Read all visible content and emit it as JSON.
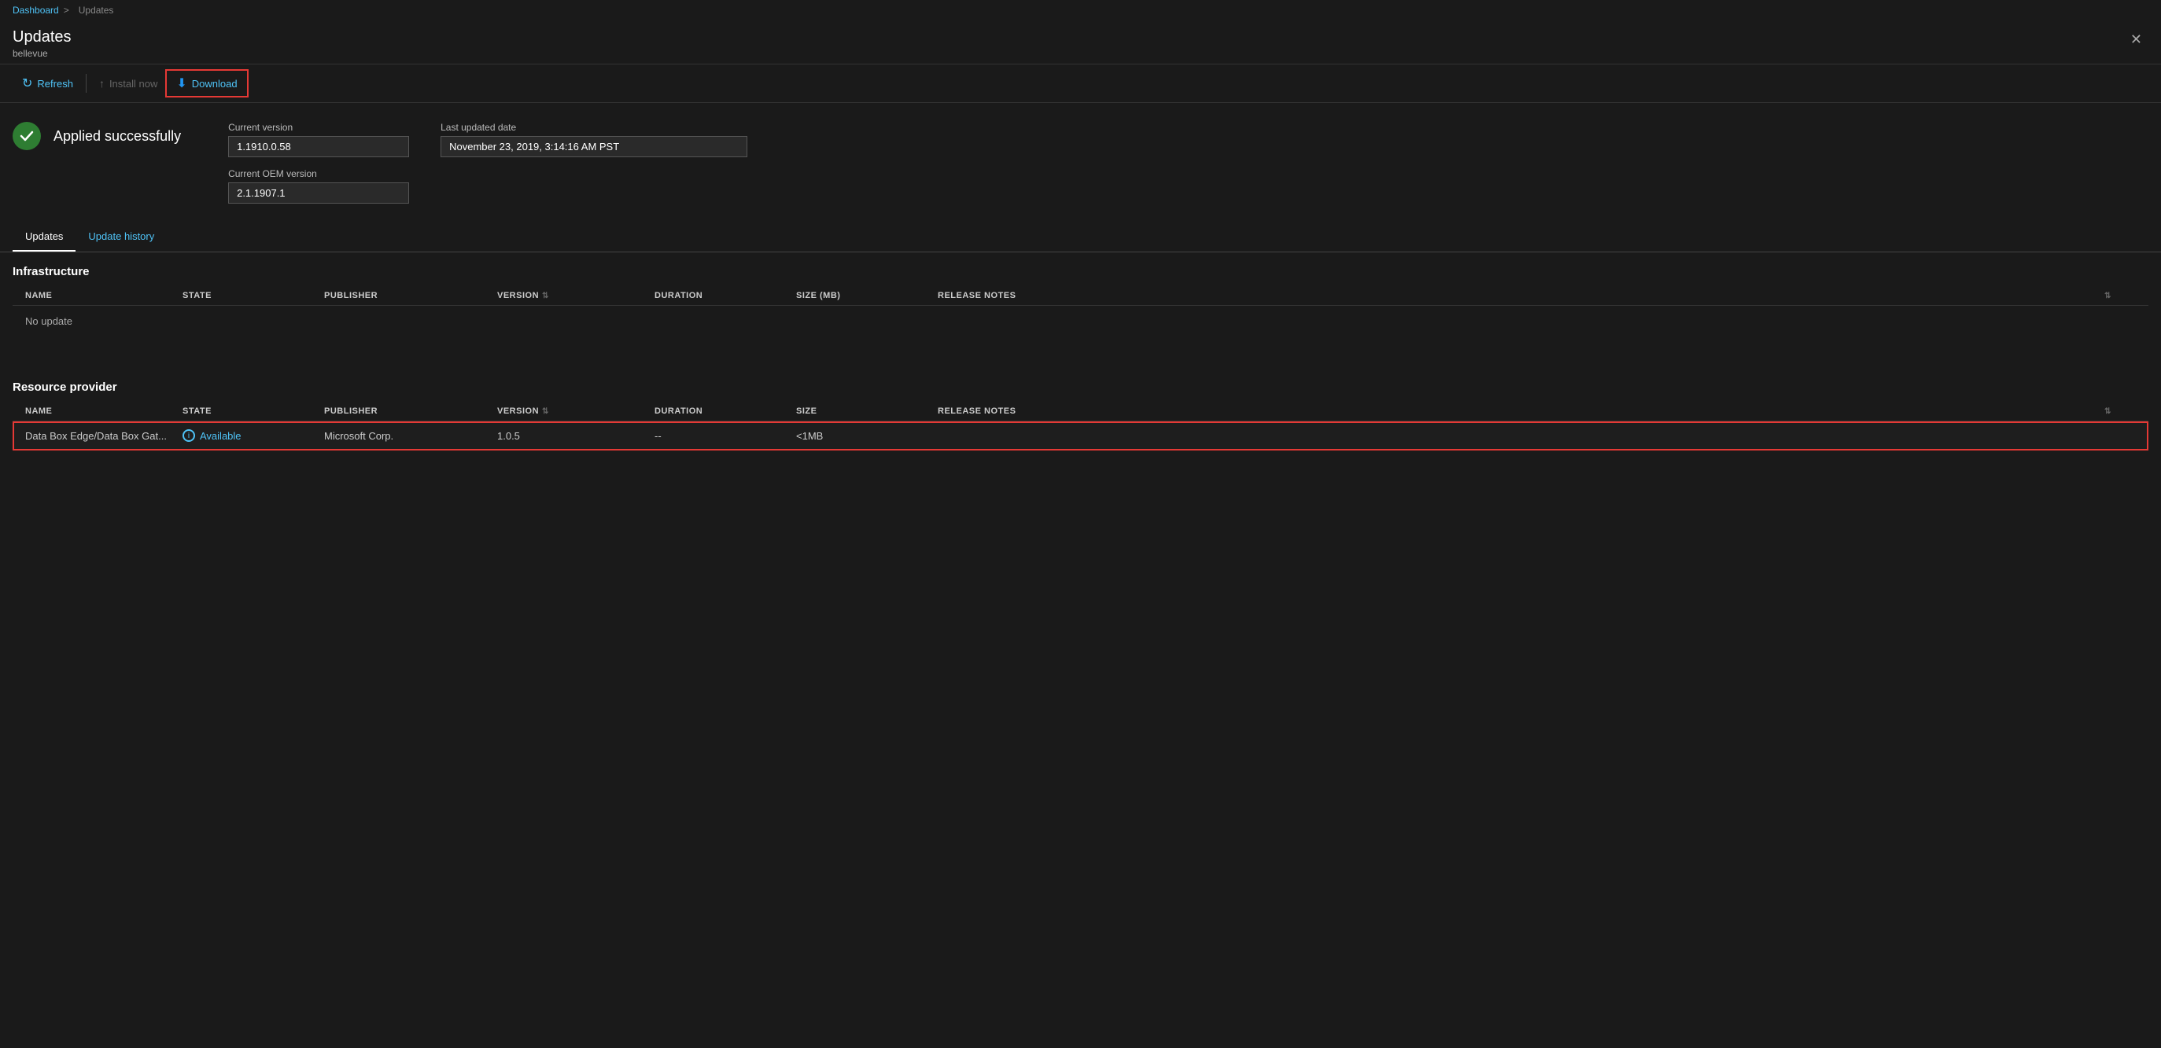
{
  "breadcrumb": {
    "dashboard_label": "Dashboard",
    "separator": ">",
    "current_label": "Updates"
  },
  "header": {
    "title": "Updates",
    "subtitle": "bellevue",
    "close_label": "✕"
  },
  "toolbar": {
    "refresh_label": "Refresh",
    "install_now_label": "Install now",
    "download_label": "Download"
  },
  "status": {
    "applied_text": "Applied successfully",
    "current_version_label": "Current version",
    "current_version_value": "1.1910.0.58",
    "current_oem_label": "Current OEM version",
    "current_oem_value": "2.1.1907.1",
    "last_updated_label": "Last updated date",
    "last_updated_value": "November 23, 2019, 3:14:16 AM PST"
  },
  "tabs": {
    "updates_label": "Updates",
    "history_label": "Update history"
  },
  "infrastructure": {
    "section_title": "Infrastructure",
    "columns": {
      "name": "NAME",
      "state": "STATE",
      "publisher": "PUBLISHER",
      "version": "VERSION",
      "duration": "DURATION",
      "size_mb": "SIZE (MB)",
      "release_notes": "RELEASE NOTES"
    },
    "no_update_text": "No update"
  },
  "resource_provider": {
    "section_title": "Resource provider",
    "columns": {
      "name": "NAME",
      "state": "STATE",
      "publisher": "PUBLISHER",
      "version": "VERSION",
      "duration": "DURATION",
      "size": "SIZE",
      "release_notes": "RELEASE NOTES"
    },
    "rows": [
      {
        "name": "Data Box Edge/Data Box Gat...",
        "state": "Available",
        "publisher": "Microsoft Corp.",
        "version": "1.0.5",
        "duration": "--",
        "size": "<1MB",
        "release_notes": ""
      }
    ]
  }
}
